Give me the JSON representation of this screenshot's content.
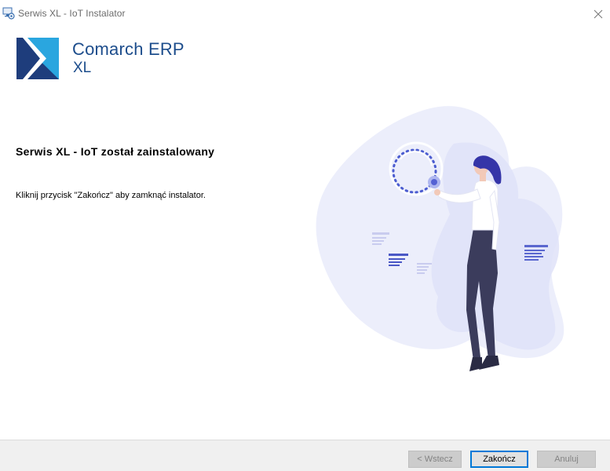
{
  "window": {
    "title": "Serwis XL - IoT Instalator",
    "app_icon": "installer-monitor-icon",
    "close_icon": "close-icon"
  },
  "brand": {
    "line1": "Comarch ERP",
    "line2": "XL",
    "logo_icon": "comarch-logo-icon",
    "color": "#1d4d8c"
  },
  "content": {
    "heading": "Serwis XL - IoT został zainstalowany",
    "description": "Kliknij przycisk \"Zakończ\" aby zamknąć instalator.",
    "illustration": "woman-touching-hologram-illustration"
  },
  "footer": {
    "back_label": "< Wstecz",
    "finish_label": "Zakończ",
    "cancel_label": "Anuluj",
    "accent": "#0078d7"
  }
}
